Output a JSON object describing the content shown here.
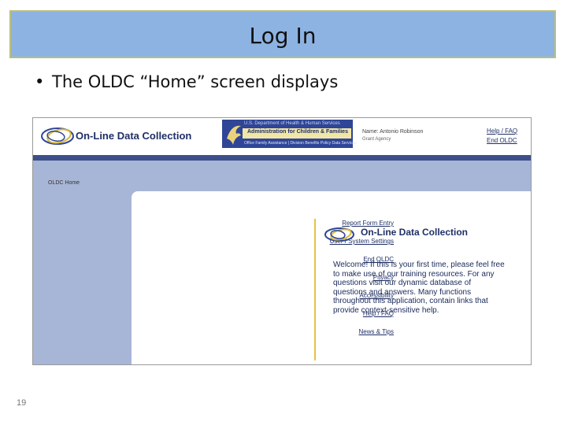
{
  "slide": {
    "title": "Log In",
    "bullet": "The OLDC “Home” screen displays",
    "slide_number": "19"
  },
  "screenshot": {
    "header": {
      "app_name": "On-Line Data Collection",
      "agency_line_top": "U.S. Department of Health & Human Services",
      "agency_name": "Administration for Children & Families",
      "agency_line_bottom": "Office Family Assistance | Division Benefits Policy Data Services",
      "user_name": "Name: Antonio Robinson",
      "user_role": "Grant Agency",
      "help_link": "Help / FAQ",
      "end_link": "End OLDC"
    },
    "breadcrumb": "OLDC Home",
    "menu": [
      "Report Form Entry",
      "User / System Settings",
      "End OLDC",
      "Privacy",
      "Accessibility",
      "Help / FAQ",
      "News & Tips"
    ],
    "welcome": {
      "title": "On-Line Data Collection",
      "text": "Welcome! If this is your first time, please feel free to make use of our training resources. For any questions visit our dynamic database of questions and answers. Many functions throughout this application, contain links that provide context-sensitive help."
    }
  },
  "colors": {
    "title_bar": "#8db3e2",
    "title_border": "#b9bf79",
    "screenshot_bg": "#a7b5d6",
    "header_bar_dark": "#3d4f8a",
    "accent_gold": "#e2c24a",
    "link_navy": "#1f2f66"
  },
  "icons": {
    "app_logo": "oval-rings-logo-icon",
    "agency_logo": "eagle-icon",
    "bullet": "bullet-dot-icon"
  }
}
